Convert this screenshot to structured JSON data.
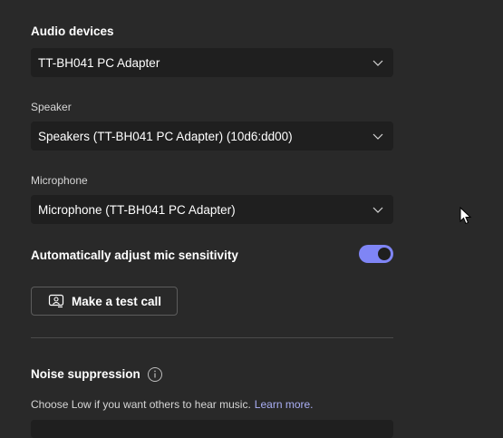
{
  "audio_devices": {
    "title": "Audio devices",
    "selected": "TT-BH041 PC Adapter"
  },
  "speaker": {
    "label": "Speaker",
    "selected": "Speakers (TT-BH041 PC Adapter) (10d6:dd00)"
  },
  "microphone": {
    "label": "Microphone",
    "selected": "Microphone (TT-BH041 PC Adapter)"
  },
  "auto_mic": {
    "label": "Automatically adjust mic sensitivity",
    "enabled": true
  },
  "test_call": {
    "label": "Make a test call"
  },
  "noise_suppression": {
    "title": "Noise suppression",
    "helper": "Choose Low if you want others to hear music.",
    "learn_more": "Learn more."
  },
  "colors": {
    "background": "#292929",
    "field": "#1f1f1f",
    "accent": "#7f85f5",
    "link": "#aaaff5"
  },
  "icons": [
    "chevron-down-icon",
    "call-icon",
    "info-icon",
    "mouse-cursor-icon"
  ]
}
